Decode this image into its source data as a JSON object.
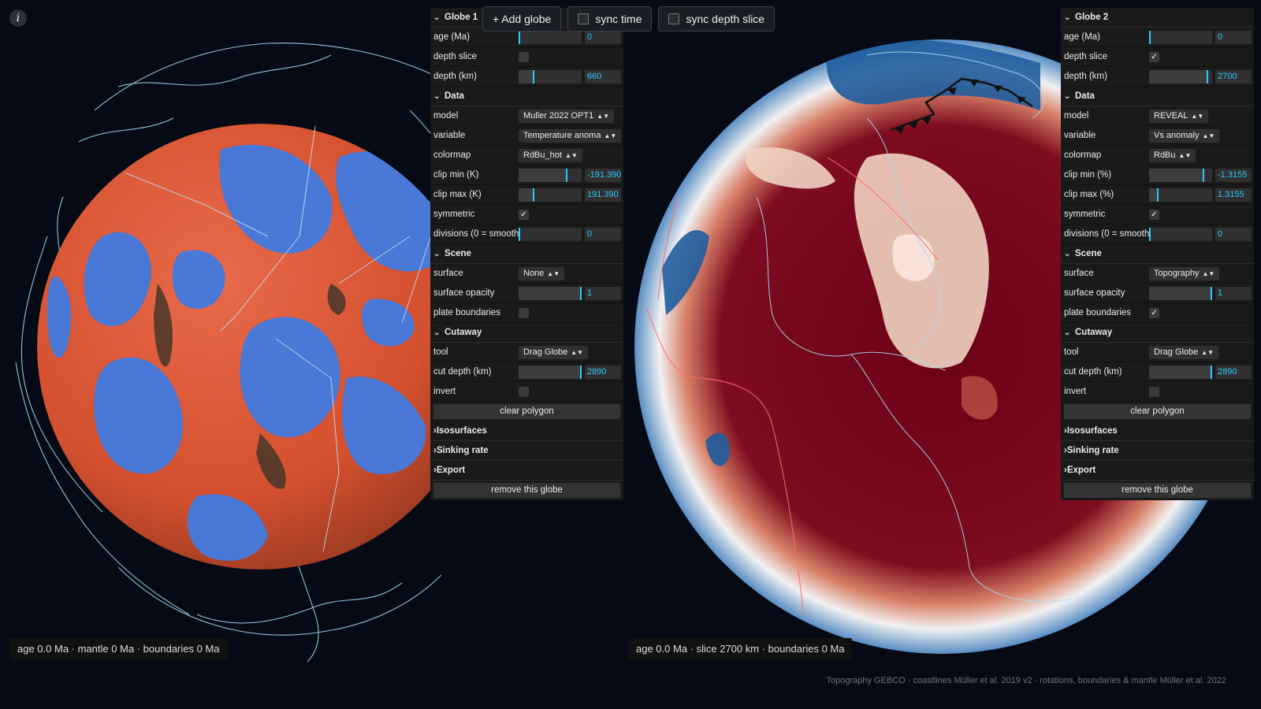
{
  "info_label": "i",
  "top_buttons": {
    "add_globe": "+ Add globe",
    "sync_time": "sync time",
    "sync_depth": "sync depth slice"
  },
  "globe1": {
    "title": "Globe 1",
    "age_label": "age (Ma)",
    "age_value": "0",
    "age_fraction": 0.0,
    "depth_slice_label": "depth slice",
    "depth_slice_checked": false,
    "depth_label": "depth (km)",
    "depth_value": "660",
    "depth_fraction": 0.23,
    "data_title": "Data",
    "model_label": "model",
    "model_value": "Muller 2022 OPT1",
    "variable_label": "variable",
    "variable_value": "Temperature anoma",
    "colormap_label": "colormap",
    "colormap_value": "RdBu_hot",
    "clipmin_label": "clip min (K)",
    "clipmin_value": "-191.390",
    "clipmin_fraction": 0.77,
    "clipmax_label": "clip max (K)",
    "clipmax_value": "191.390",
    "clipmax_fraction": 0.23,
    "symmetric_label": "symmetric",
    "symmetric_checked": true,
    "divisions_label": "divisions (0 = smooth)",
    "divisions_value": "0",
    "divisions_fraction": 0.0,
    "scene_title": "Scene",
    "surface_label": "surface",
    "surface_value": "None",
    "opacity_label": "surface opacity",
    "opacity_value": "1",
    "opacity_fraction": 1.0,
    "plates_label": "plate boundaries",
    "plates_checked": false,
    "cutaway_title": "Cutaway",
    "tool_label": "tool",
    "tool_value": "Drag Globe",
    "cut_label": "cut depth (km)",
    "cut_value": "2890",
    "cut_fraction": 1.0,
    "invert_label": "invert",
    "invert_checked": false,
    "clear_label": "clear polygon",
    "iso_title": "Isosurfaces",
    "sinking_title": "Sinking rate",
    "export_title": "Export",
    "remove_label": "remove this globe",
    "status": "age 0.0 Ma · mantle 0 Ma · boundaries 0 Ma"
  },
  "globe2": {
    "title": "Globe 2",
    "age_label": "age (Ma)",
    "age_value": "0",
    "age_fraction": 0.0,
    "depth_slice_label": "depth slice",
    "depth_slice_checked": true,
    "depth_label": "depth (km)",
    "depth_value": "2700",
    "depth_fraction": 0.93,
    "data_title": "Data",
    "model_label": "model",
    "model_value": "REVEAL",
    "variable_label": "variable",
    "variable_value": "Vs anomaly",
    "colormap_label": "colormap",
    "colormap_value": "RdBu",
    "clipmin_label": "clip min (%)",
    "clipmin_value": "-1.3155",
    "clipmin_fraction": 0.87,
    "clipmax_label": "clip max (%)",
    "clipmax_value": "1.3155",
    "clipmax_fraction": 0.13,
    "symmetric_label": "symmetric",
    "symmetric_checked": true,
    "divisions_label": "divisions (0 = smooth)",
    "divisions_value": "0",
    "divisions_fraction": 0.0,
    "scene_title": "Scene",
    "surface_label": "surface",
    "surface_value": "Topography",
    "opacity_label": "surface opacity",
    "opacity_value": "1",
    "opacity_fraction": 1.0,
    "plates_label": "plate boundaries",
    "plates_checked": true,
    "cutaway_title": "Cutaway",
    "tool_label": "tool",
    "tool_value": "Drag Globe",
    "cut_label": "cut depth (km)",
    "cut_value": "2890",
    "cut_fraction": 1.0,
    "invert_label": "invert",
    "invert_checked": false,
    "clear_label": "clear polygon",
    "iso_title": "Isosurfaces",
    "sinking_title": "Sinking rate",
    "export_title": "Export",
    "remove_label": "remove this globe",
    "status": "age 0.0 Ma · slice 2700 km · boundaries 0 Ma"
  },
  "credits": "Topography GEBCO · coastlines Müller et al. 2019 v2 · rotations, boundaries & mantle Müller et al. 2022",
  "colors": {
    "background": "#060a15",
    "accent": "#2cc9ff",
    "hot": "#e0573a",
    "cold": "#4a78d6",
    "deep_red": "#6b0016",
    "coast": "#9fd6f2"
  }
}
